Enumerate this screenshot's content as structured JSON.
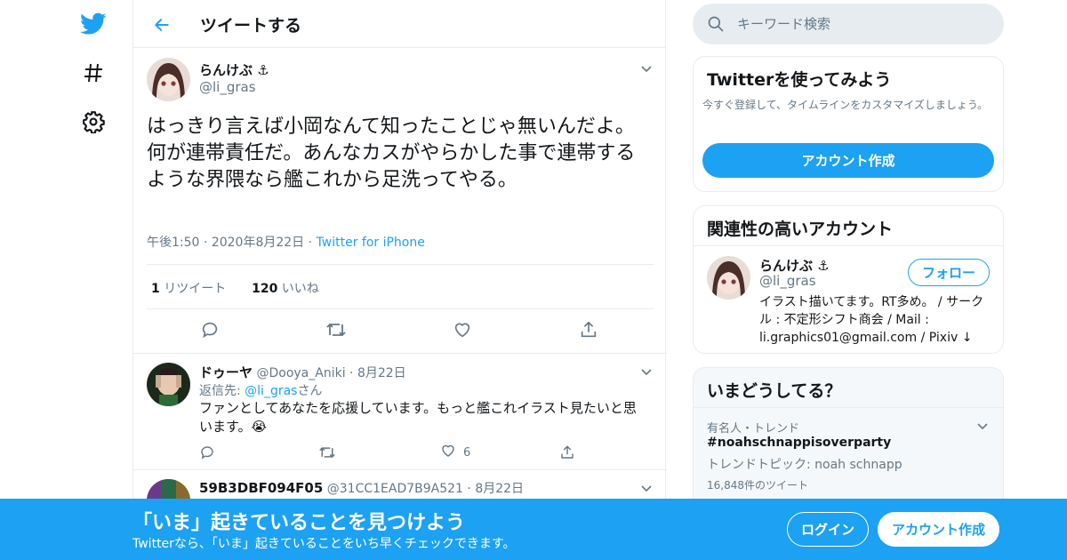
{
  "nav": {
    "icons": [
      "twitter-bird-icon",
      "hashtag-icon",
      "gear-icon"
    ]
  },
  "header": {
    "title": "ツイートする"
  },
  "tweet": {
    "name": "らんけぶ ⚓",
    "handle": "@li_gras",
    "text_line1": "はっきり言えば小岡なんて知ったことじゃ無いんだよ。",
    "text_line2": "何が連帯責任だ。あんなカスがやらかした事で連帯するような界隈なら艦これから足洗ってやる。",
    "time": "午後1:50",
    "date": "2020年8月22日",
    "source": "Twitter for iPhone",
    "retweet_count": "1",
    "retweet_label": "リツイート",
    "like_count": "120",
    "like_label": "いいね"
  },
  "replies": [
    {
      "name": "ドゥーヤ",
      "handle": "@Dooya_Aniki",
      "date": "8月22日",
      "reply_to_prefix": "返信先: ",
      "reply_to_handle": "@li_gras",
      "reply_to_suffix": "さん",
      "text": "ファンとしてあなたを応援しています。もっと艦これイラスト見たいと思います。😭",
      "like_count": "6"
    },
    {
      "name": "59B3DBF094F05",
      "handle": "@31CC1EAD7B9A521",
      "date": "8月22日"
    }
  ],
  "search": {
    "placeholder": "キーワード検索"
  },
  "signup_card": {
    "title": "Twitterを使ってみよう",
    "desc": "今すぐ登録して、タイムラインをカスタマイズしましょう。",
    "button": "アカウント作成"
  },
  "related_card": {
    "title": "関連性の高いアカウント",
    "name": "らんけぶ ⚓",
    "handle": "@li_gras",
    "follow": "フォロー",
    "bio": "イラスト描いてます。RT多め。 / サークル : 不定形シフト商会 / Mail : li.graphics01@gmail.com / Pixiv ↓"
  },
  "trends_card": {
    "title": "いまどうしてる？",
    "context": "有名人・トレンド",
    "tag": "#noahschnappisoverparty",
    "topic": "トレンドトピック: noah schnapp",
    "count": "16,848件のツイート"
  },
  "bottom_bar": {
    "title": "「いま」起きていることを見つけよう",
    "subtitle": "Twitterなら、「いま」起きていることをいち早くチェックできます。",
    "login": "ログイン",
    "signup": "アカウント作成"
  },
  "colors": {
    "accent": "#1da1f2",
    "muted": "#657786",
    "border": "#e6ecf0"
  }
}
